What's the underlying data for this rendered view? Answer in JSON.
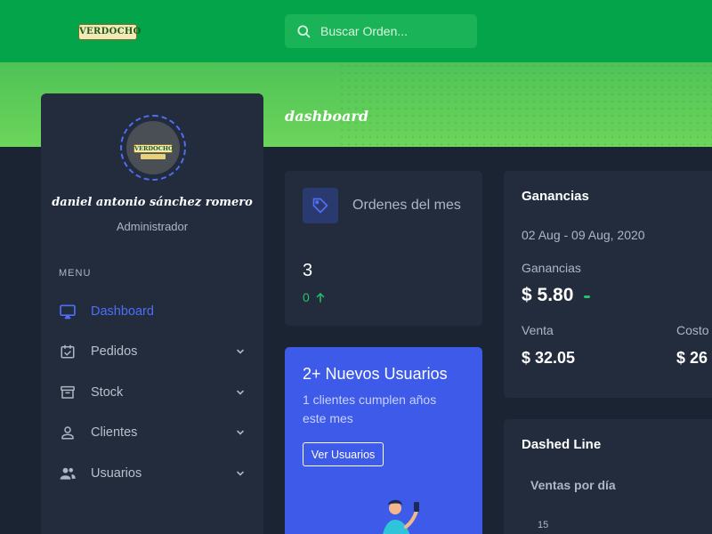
{
  "header": {
    "logo_text": "VERDOCHO",
    "search_placeholder": "Buscar Orden..."
  },
  "banner": {
    "page_title": "dashboard"
  },
  "sidebar": {
    "avatar_label": "VERDOCHO",
    "user_name": "daniel antonio sánchez romero",
    "user_role": "Administrador",
    "menu_heading": "MENU",
    "items": [
      {
        "label": "Dashboard",
        "icon": "monitor-icon",
        "active": true
      },
      {
        "label": "Pedidos",
        "icon": "calendar-icon",
        "expandable": true
      },
      {
        "label": "Stock",
        "icon": "archive-icon",
        "expandable": true
      },
      {
        "label": "Clientes",
        "icon": "user-icon",
        "expandable": true
      },
      {
        "label": "Usuarios",
        "icon": "users-icon",
        "expandable": true
      }
    ]
  },
  "orders_card": {
    "title": "Ordenes del mes",
    "count": "3",
    "delta": "0",
    "icon": "tag-icon",
    "delta_color": "#27c26a"
  },
  "users_card": {
    "title": "2+ Nuevos Usuarios",
    "subtitle": "1 clientes cumplen años este mes",
    "button_label": "Ver Usuarios",
    "background": "#3d5ae8"
  },
  "earnings_card": {
    "title": "Ganancias",
    "date_range": "02 Aug - 09 Aug, 2020",
    "earnings_label": "Ganancias",
    "earnings_value": "$ 5.80",
    "sale_label": "Venta",
    "sale_value": "$ 32.05",
    "cost_label": "Costo",
    "cost_value": "$ 26"
  },
  "chart_card": {
    "title": "Dashed Line",
    "subtitle": "Ventas por día",
    "y_tick": "15"
  },
  "colors": {
    "header_green": "#04a44b",
    "banner_green": "#6cd55a",
    "accent_blue": "#4f6ef7",
    "positive_green": "#27c26a"
  }
}
